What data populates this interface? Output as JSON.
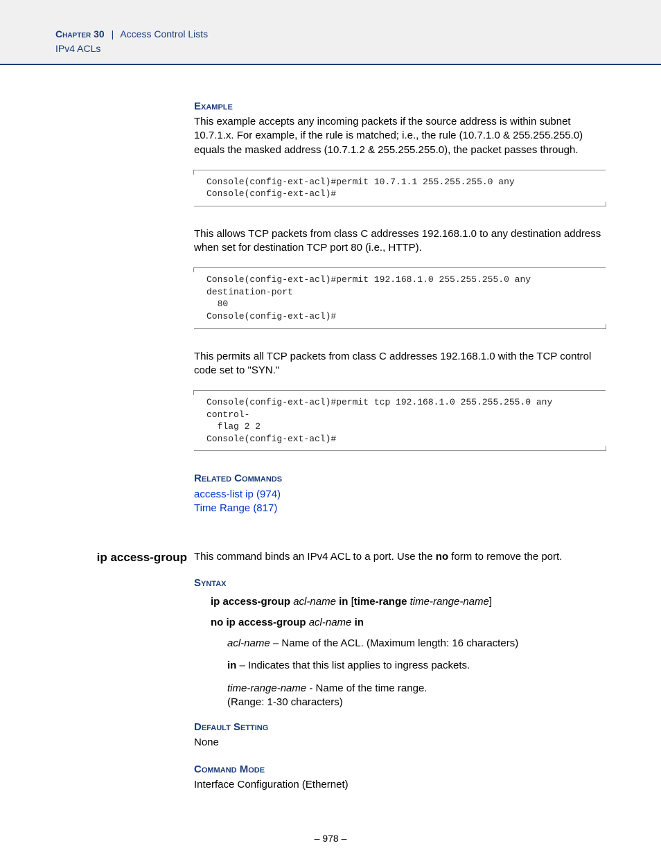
{
  "header": {
    "chapter_label": "Chapter 30",
    "separator": "|",
    "title": "Access Control Lists",
    "subtitle": "IPv4 ACLs"
  },
  "example": {
    "label": "Example",
    "intro": "This example accepts any incoming packets if the source address is within subnet 10.7.1.x. For example, if the rule is matched; i.e., the rule (10.7.1.0 & 255.255.255.0) equals the masked address (10.7.1.2 & 255.255.255.0), the packet passes through.",
    "code1": "Console(config-ext-acl)#permit 10.7.1.1 255.255.255.0 any\nConsole(config-ext-acl)#",
    "para2": "This allows TCP packets from class C addresses 192.168.1.0 to any destination address when set for destination TCP port 80 (i.e., HTTP).",
    "code2": "Console(config-ext-acl)#permit 192.168.1.0 255.255.255.0 any destination-port \n  80\nConsole(config-ext-acl)#",
    "para3": "This permits all TCP packets from class C addresses 192.168.1.0 with the TCP control code set to \"SYN.\"",
    "code3": "Console(config-ext-acl)#permit tcp 192.168.1.0 255.255.255.0 any  control-\n  flag 2 2\nConsole(config-ext-acl)#"
  },
  "related": {
    "label": "Related Commands",
    "links": [
      "access-list ip (974)",
      "Time Range (817)"
    ]
  },
  "command": {
    "name": "ip access-group",
    "desc_pre": "This command binds an IPv4 ACL to a port. Use the ",
    "desc_bold": "no",
    "desc_post": " form to remove the port.",
    "syntax": {
      "label": "Syntax",
      "line1": {
        "b1": "ip access-group",
        "i1": " acl-name ",
        "b2": "in",
        "t1": " [",
        "b3": "time-range",
        "i2": " time-range-name",
        "t2": "]"
      },
      "line2": {
        "b1": "no ip access-group",
        "i1": " acl-name ",
        "b2": "in"
      },
      "params": {
        "p1": {
          "name": "acl-name",
          "desc": " – Name of the ACL. (Maximum length: 16 characters)"
        },
        "p2": {
          "name": "in",
          "desc": " – Indicates that this list applies to ingress packets."
        },
        "p3": {
          "name": "time-range-name",
          "desc_l1": " - Name of the time range.",
          "desc_l2": "(Range: 1-30 characters)"
        }
      }
    },
    "default": {
      "label": "Default Setting",
      "value": "None"
    },
    "mode": {
      "label": "Command Mode",
      "value": "Interface Configuration (Ethernet)"
    }
  },
  "footer": {
    "page": "–  978  –"
  }
}
